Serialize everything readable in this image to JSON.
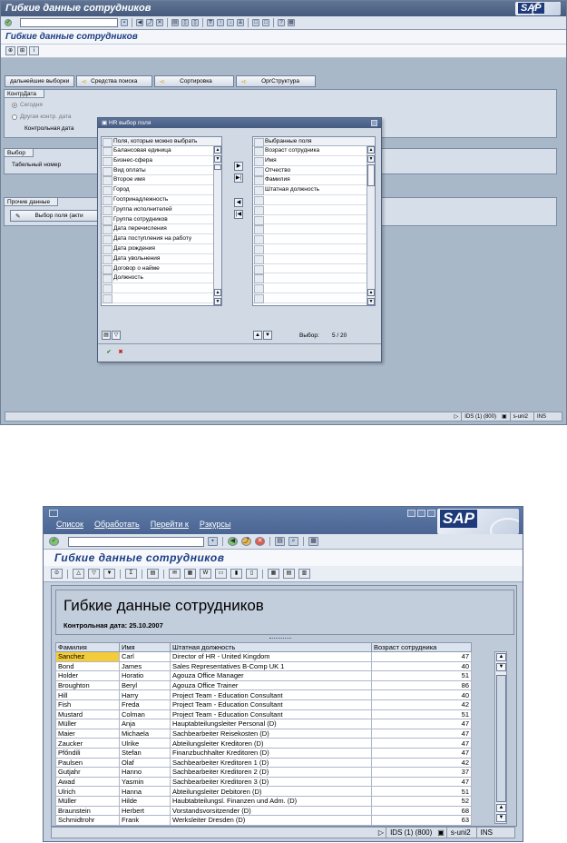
{
  "screen1": {
    "window_title": "Гибкие данные сотрудников",
    "app_title": "Гибкие данные сотрудников",
    "buttons": [
      "дальнейшие выборки",
      "Средства поиска",
      "Сортировка",
      "ОргСтруктура"
    ],
    "kontr_group": {
      "label": "КонтрДата",
      "radio_today": "Сегодня",
      "radio_other": "Другая контр. дата",
      "field_label": "Контрольная дата"
    },
    "vybor_group": {
      "label": "Выбор",
      "field_label": "Табельный номер"
    },
    "other_group": {
      "label": "Прочие данные",
      "button_label": "Выбор поля (акти"
    },
    "dialog": {
      "title": "HR выбор поля",
      "left_header": "Поля, которые можно выбрать",
      "left_items": [
        "Балансовая единица",
        "Бизнес-сфера",
        "Вид оплаты",
        "Второе имя",
        "Город",
        "Госпринадлежность",
        "Группа исполнителей",
        "Группа сотрудников",
        "Дата перечисления",
        "Дата поступления на работу",
        "Дата рождения",
        "Дата увольнения",
        "Договор о найме",
        "Должность"
      ],
      "right_header": "Выбранные поля",
      "right_items": [
        "Возраст сотрудника",
        "Имя",
        "Отчество",
        "Фамилия",
        "Штатная должность"
      ],
      "selection_label": "Выбор:",
      "selection_value": "5  /  20"
    },
    "status": {
      "system": "IDS (1) (800)",
      "server": "s-uni2",
      "mode": "INS"
    }
  },
  "screen2": {
    "menu": [
      "Список",
      "Обработать",
      "Перейти к",
      "Рзкурсы"
    ],
    "app_title": "Гибкие данные сотрудников",
    "report_title": "Гибкие данные сотрудников",
    "report_date": "Контрольная дата: 25.10.2007",
    "columns": [
      "Фамилия",
      "Имя",
      "Штатная должность",
      "Возраст сотрудника"
    ],
    "rows": [
      [
        "Sanchez",
        "Carl",
        "Director of HR - United Kingdom",
        "47"
      ],
      [
        "Bond",
        "James",
        "Sales Representatives B-Comp UK 1",
        "40"
      ],
      [
        "Holder",
        "Horatio",
        "Agouza Office Manager",
        "51"
      ],
      [
        "Broughton",
        "Beryl",
        "Agouza Office Trainer",
        "86"
      ],
      [
        "Hill",
        "Harry",
        "Project Team - Education Consultant",
        "40"
      ],
      [
        "Fish",
        "Freda",
        "Project Team - Education Consultant",
        "42"
      ],
      [
        "Mustard",
        "Colman",
        "Project Team - Education Consultant",
        "51"
      ],
      [
        "Müller",
        "Anja",
        "Hauptabteilungsleiter Personal (D)",
        "47"
      ],
      [
        "Maier",
        "Michaela",
        "Sachbearbeiter Reisekosten (D)",
        "47"
      ],
      [
        "Zaucker",
        "Ulrike",
        "Abteilungsleiter Kreditoren (D)",
        "47"
      ],
      [
        "Pfőndili",
        "Stefan",
        "Finanzbuchhalter Kreditoren (D)",
        "47"
      ],
      [
        "Paulsen",
        "Olaf",
        "Sachbearbeiter Kreditoren 1 (D)",
        "42"
      ],
      [
        "Gutjahr",
        "Hanno",
        "Sachbearbeiter Kreditoren 2 (D)",
        "37"
      ],
      [
        "Awad",
        "Yasmin",
        "Sachbearbeiter Kreditoren 3 (D)",
        "47"
      ],
      [
        "Ulrich",
        "Hanna",
        "Abteilungsleiter Debitoren (D)",
        "51"
      ],
      [
        "Müller",
        "Hilde",
        "Haubtabteilungsl. Finanzen und Adm. (D)",
        "52"
      ],
      [
        "Braunstein",
        "Herbert",
        "Vorstandsvorsitzender (D)",
        "68"
      ],
      [
        "Schmidtrohr",
        "Frank",
        "Werksleiter Dresden (D)",
        "63"
      ]
    ],
    "status": {
      "system": "IDS (1) (800)",
      "server": "s-uni2",
      "mode": "INS"
    }
  }
}
